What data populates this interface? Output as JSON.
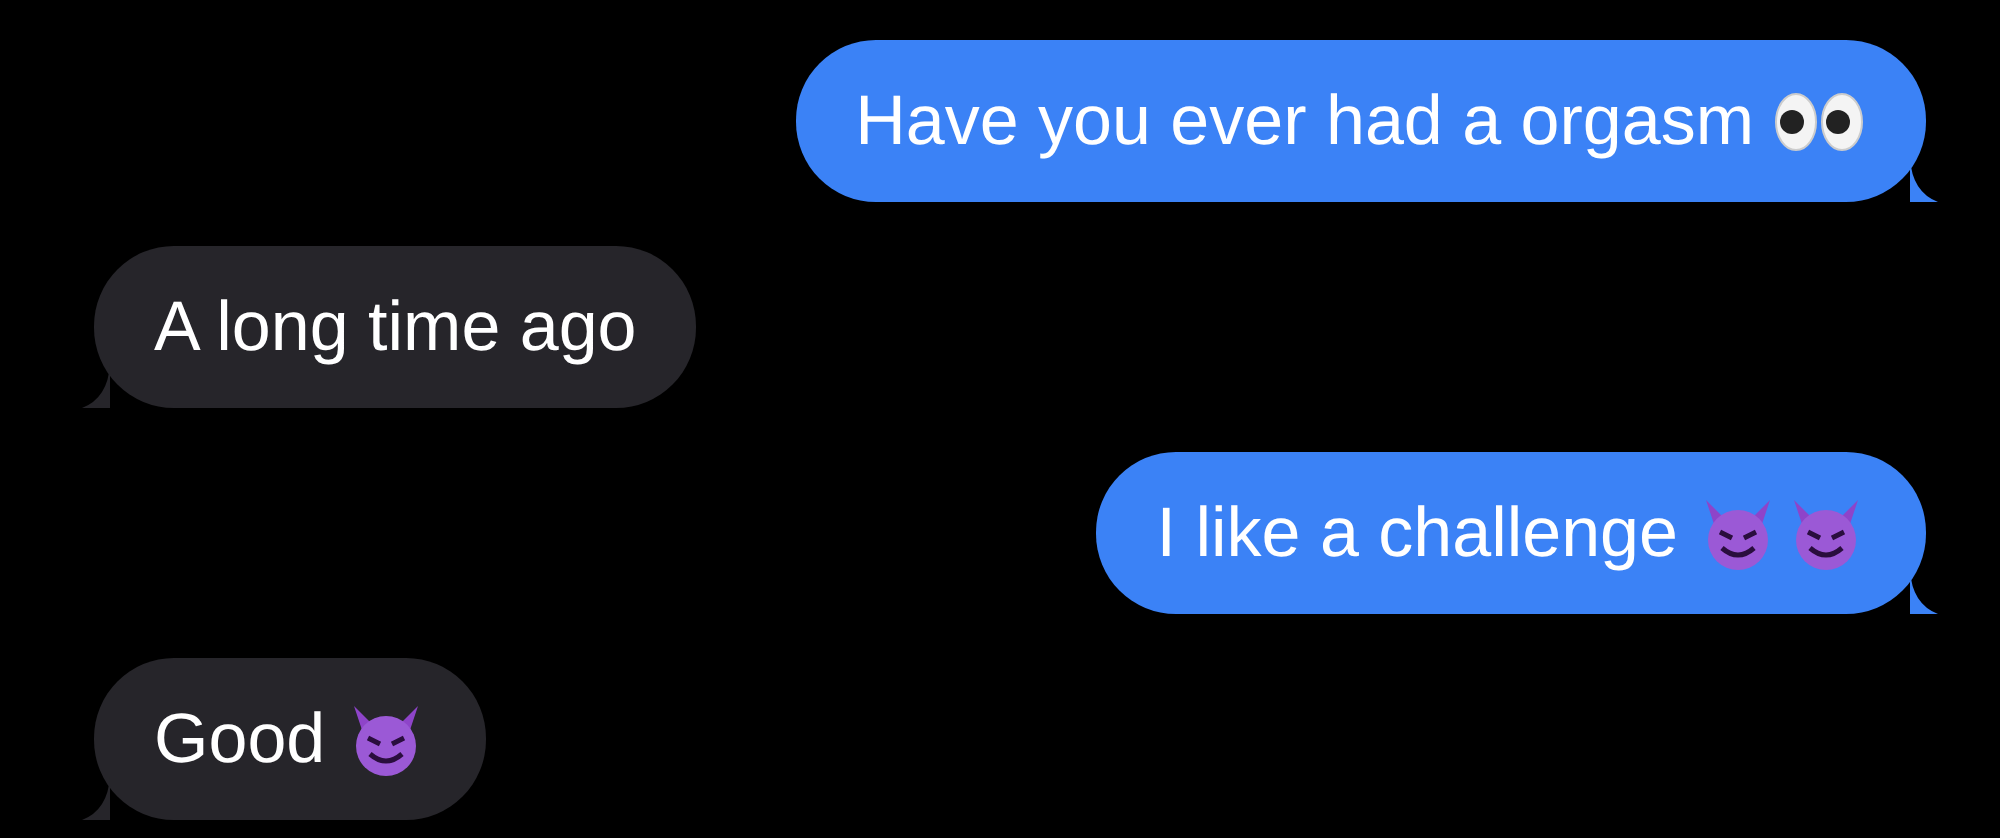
{
  "messages": [
    {
      "kind": "sent",
      "text": "Have you ever had a orgasm",
      "emoji": [
        {
          "kind": "eyes"
        }
      ]
    },
    {
      "kind": "received",
      "text": "A long time ago"
    },
    {
      "kind": "sent",
      "text": "I like a challenge",
      "emoji": [
        {
          "kind": "devil"
        },
        {
          "kind": "devil"
        }
      ]
    },
    {
      "kind": "received",
      "text": "Good",
      "emoji": [
        {
          "kind": "devil"
        }
      ]
    }
  ]
}
